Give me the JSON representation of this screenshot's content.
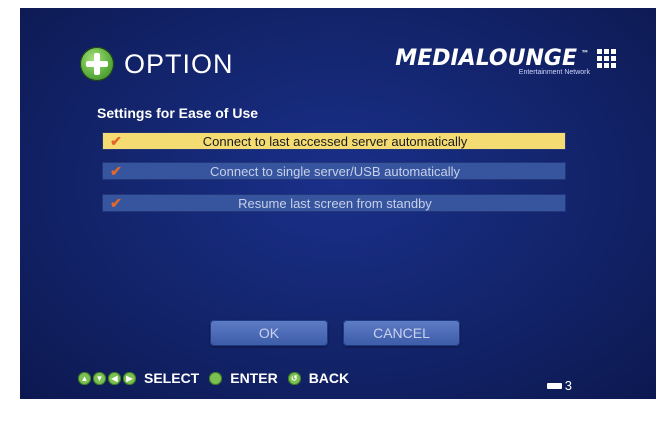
{
  "header": {
    "title": "OPTION",
    "brand_name": "MEDIALOUNGE",
    "brand_tagline": "Entertainment Network"
  },
  "section_title": "Settings for Ease of Use",
  "options": [
    {
      "label": "Connect to last accessed server automatically",
      "checked": true,
      "selected": true
    },
    {
      "label": "Connect to single server/USB automatically",
      "checked": true,
      "selected": false
    },
    {
      "label": "Resume last screen from standby",
      "checked": true,
      "selected": false
    }
  ],
  "buttons": {
    "ok": "OK",
    "cancel": "CANCEL"
  },
  "footer": {
    "select_label": "SELECT",
    "enter_label": "ENTER",
    "back_label": "BACK"
  },
  "page_number": "3",
  "colors": {
    "background": "#142670",
    "highlight": "#f5dc72",
    "check": "#e0682c",
    "remote_green": "#7cc052"
  }
}
